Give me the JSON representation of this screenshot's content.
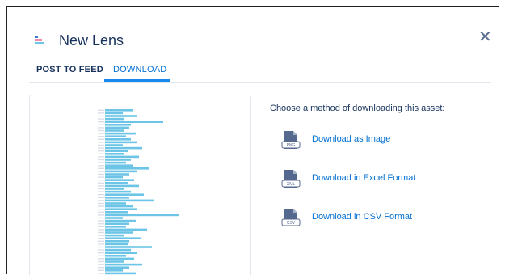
{
  "header": {
    "title": "New Lens",
    "icon": "lens-icon",
    "close_icon": "close-icon"
  },
  "tabs": [
    {
      "label": "POST TO FEED",
      "active": false
    },
    {
      "label": "DOWNLOAD",
      "active": true
    }
  ],
  "download": {
    "prompt": "Choose a method of downloading this asset:",
    "options": [
      {
        "label": "Download as Image",
        "icon_label": "PNG",
        "icon": "png-file-icon"
      },
      {
        "label": "Download in Excel Format",
        "icon_label": "XML",
        "icon": "xml-file-icon"
      },
      {
        "label": "Download in CSV Format",
        "icon_label": "CSV",
        "icon": "csv-file-icon"
      }
    ]
  },
  "colors": {
    "accent": "#0070d2",
    "bar": "#6cc4e6",
    "title": "#16325c"
  }
}
